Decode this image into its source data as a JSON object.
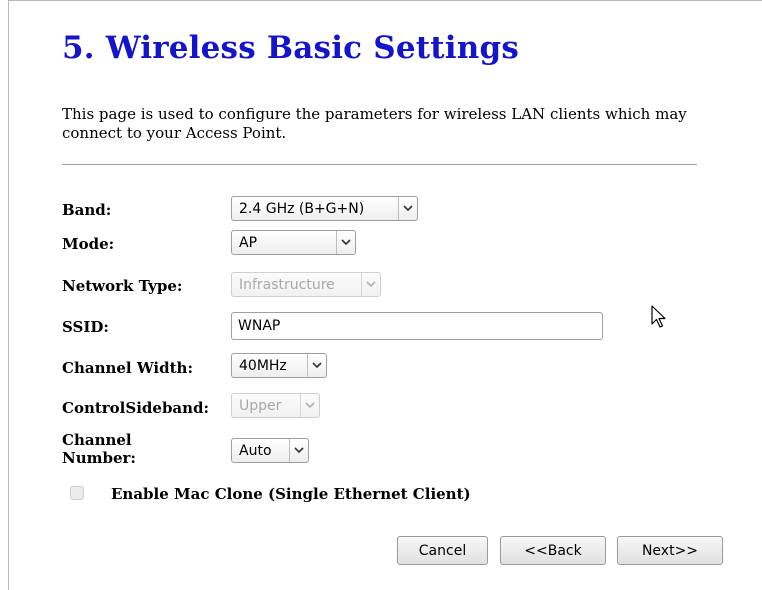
{
  "page": {
    "title": "5. Wireless Basic Settings",
    "description": "This page is used to configure the parameters for wireless LAN clients which may connect to your Access Point."
  },
  "form": {
    "band": {
      "label": "Band:",
      "value": "2.4 GHz (B+G+N)"
    },
    "mode": {
      "label": "Mode:",
      "value": "AP"
    },
    "network_type": {
      "label": "Network Type:",
      "value": "Infrastructure",
      "disabled": true
    },
    "ssid": {
      "label": "SSID:",
      "value": "WNAP"
    },
    "channel_width": {
      "label": "Channel Width:",
      "value": "40MHz"
    },
    "control_sideband": {
      "label": "ControlSideband:",
      "value": "Upper",
      "disabled": true
    },
    "channel_number": {
      "label_line1": "Channel",
      "label_line2": "Number:",
      "value": "Auto"
    },
    "mac_clone": {
      "label": "Enable Mac Clone (Single Ethernet Client)",
      "checked": false,
      "disabled": true
    }
  },
  "buttons": {
    "cancel": "Cancel",
    "back": "<<Back",
    "next": "Next>>"
  },
  "icons": {
    "dropdown": "chevron-down-icon",
    "pointer": "mouse-pointer-icon"
  }
}
